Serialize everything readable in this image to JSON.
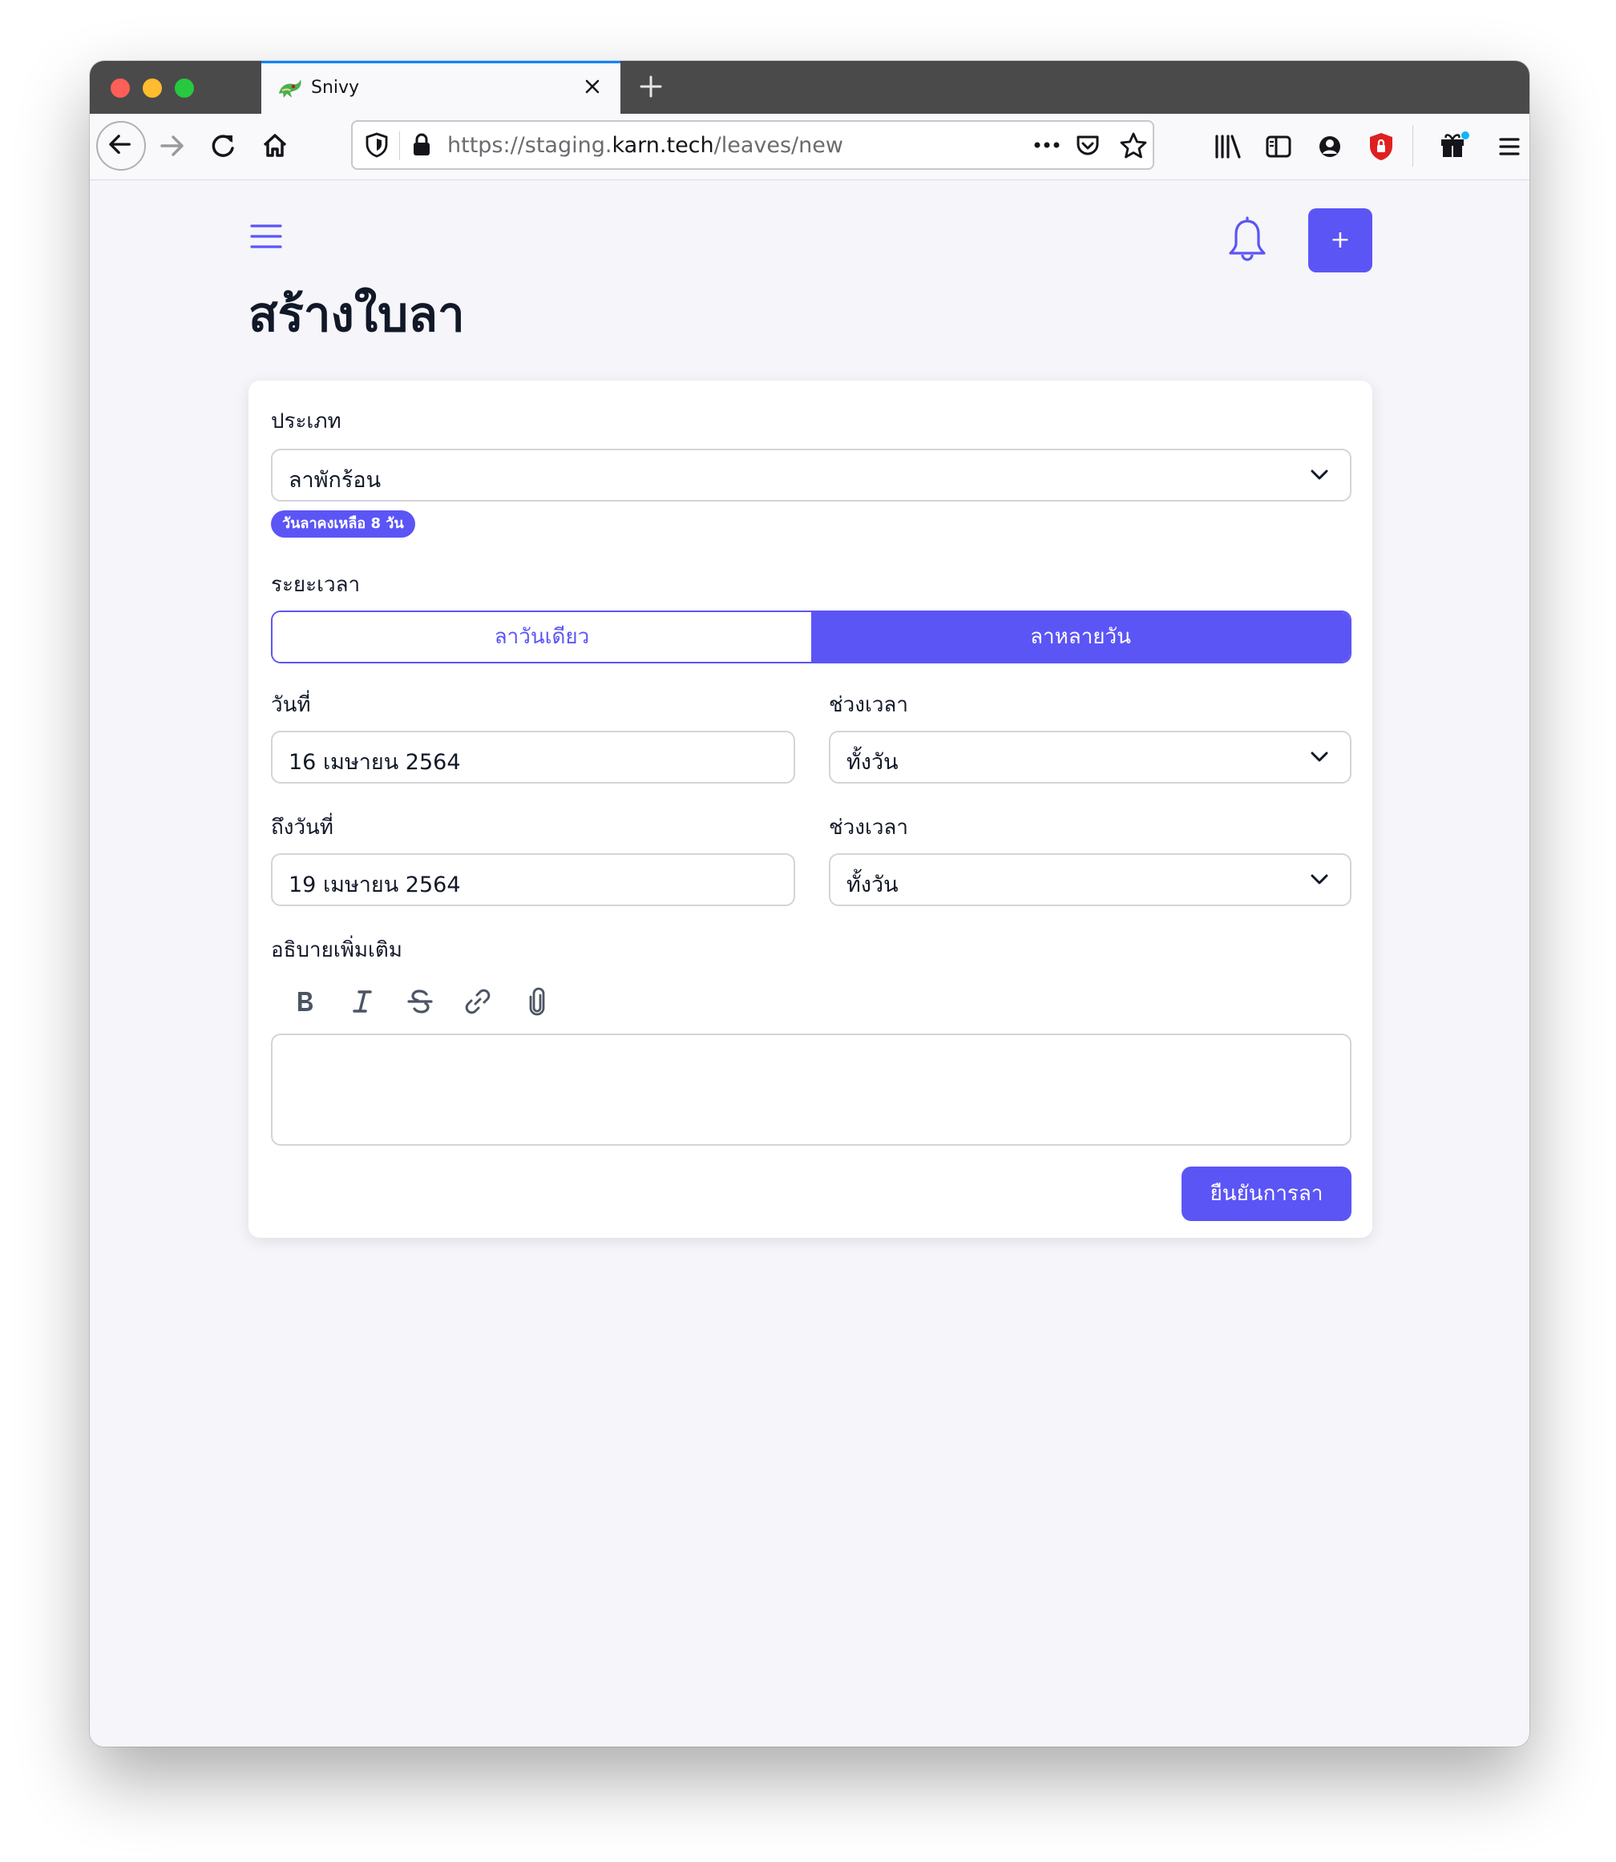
{
  "browser": {
    "tab_title": "Snivy",
    "url_prefix": "https://staging.",
    "url_host": "karn.tech",
    "url_path": "/leaves/new"
  },
  "header": {
    "add_button_label": "+"
  },
  "page": {
    "title": "สร้างใบลา"
  },
  "form": {
    "type_label": "ประเภท",
    "type_value": "ลาพักร้อน",
    "remaining_badge": "วันลาคงเหลือ 8 วัน",
    "duration_label": "ระยะเวลา",
    "duration_options": [
      "ลาวันเดียว",
      "ลาหลายวัน"
    ],
    "duration_selected": "ลาหลายวัน",
    "start_date_label": "วันที่",
    "start_date_value": "16 เมษายน 2564",
    "start_period_label": "ช่วงเวลา",
    "start_period_value": "ทั้งวัน",
    "end_date_label": "ถึงวันที่",
    "end_date_value": "19 เมษายน 2564",
    "end_period_label": "ช่วงเวลา",
    "end_period_value": "ทั้งวัน",
    "description_label": "อธิบายเพิ่มเติม",
    "description_value": "",
    "submit_label": "ยืนยันการลา"
  },
  "colors": {
    "accent": "#5b55f6",
    "tabbar": "#4a4a4a",
    "background": "#f5f5fa"
  }
}
